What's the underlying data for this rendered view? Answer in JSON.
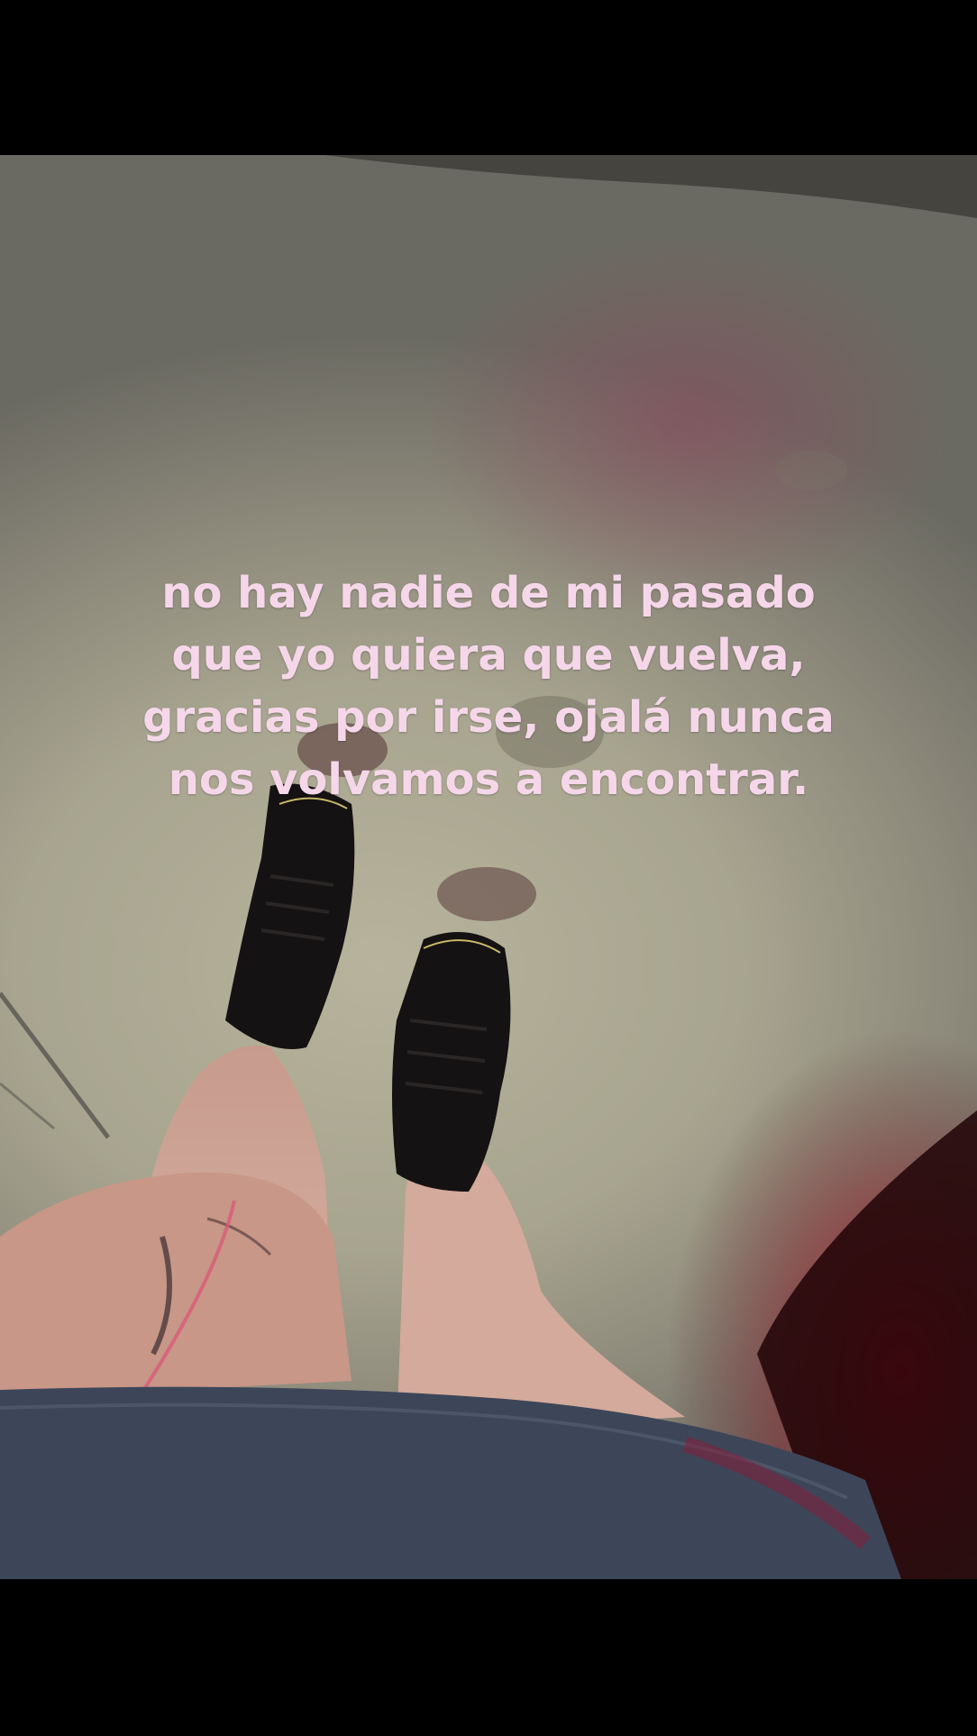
{
  "caption": {
    "lines": [
      "no hay nadie de mi pasado",
      "que yo quiera que vuelva,",
      "gracias por irse, ojalá nunca",
      "nos volvamos a encontrar."
    ]
  },
  "colors": {
    "caption_text": "#f6d7ea",
    "letterbox": "#000000",
    "pavement": "#a7a48f",
    "boot": "#111111",
    "skin": "#c9a093",
    "denim": "#3d4658",
    "red_glow": "#b0122a"
  }
}
